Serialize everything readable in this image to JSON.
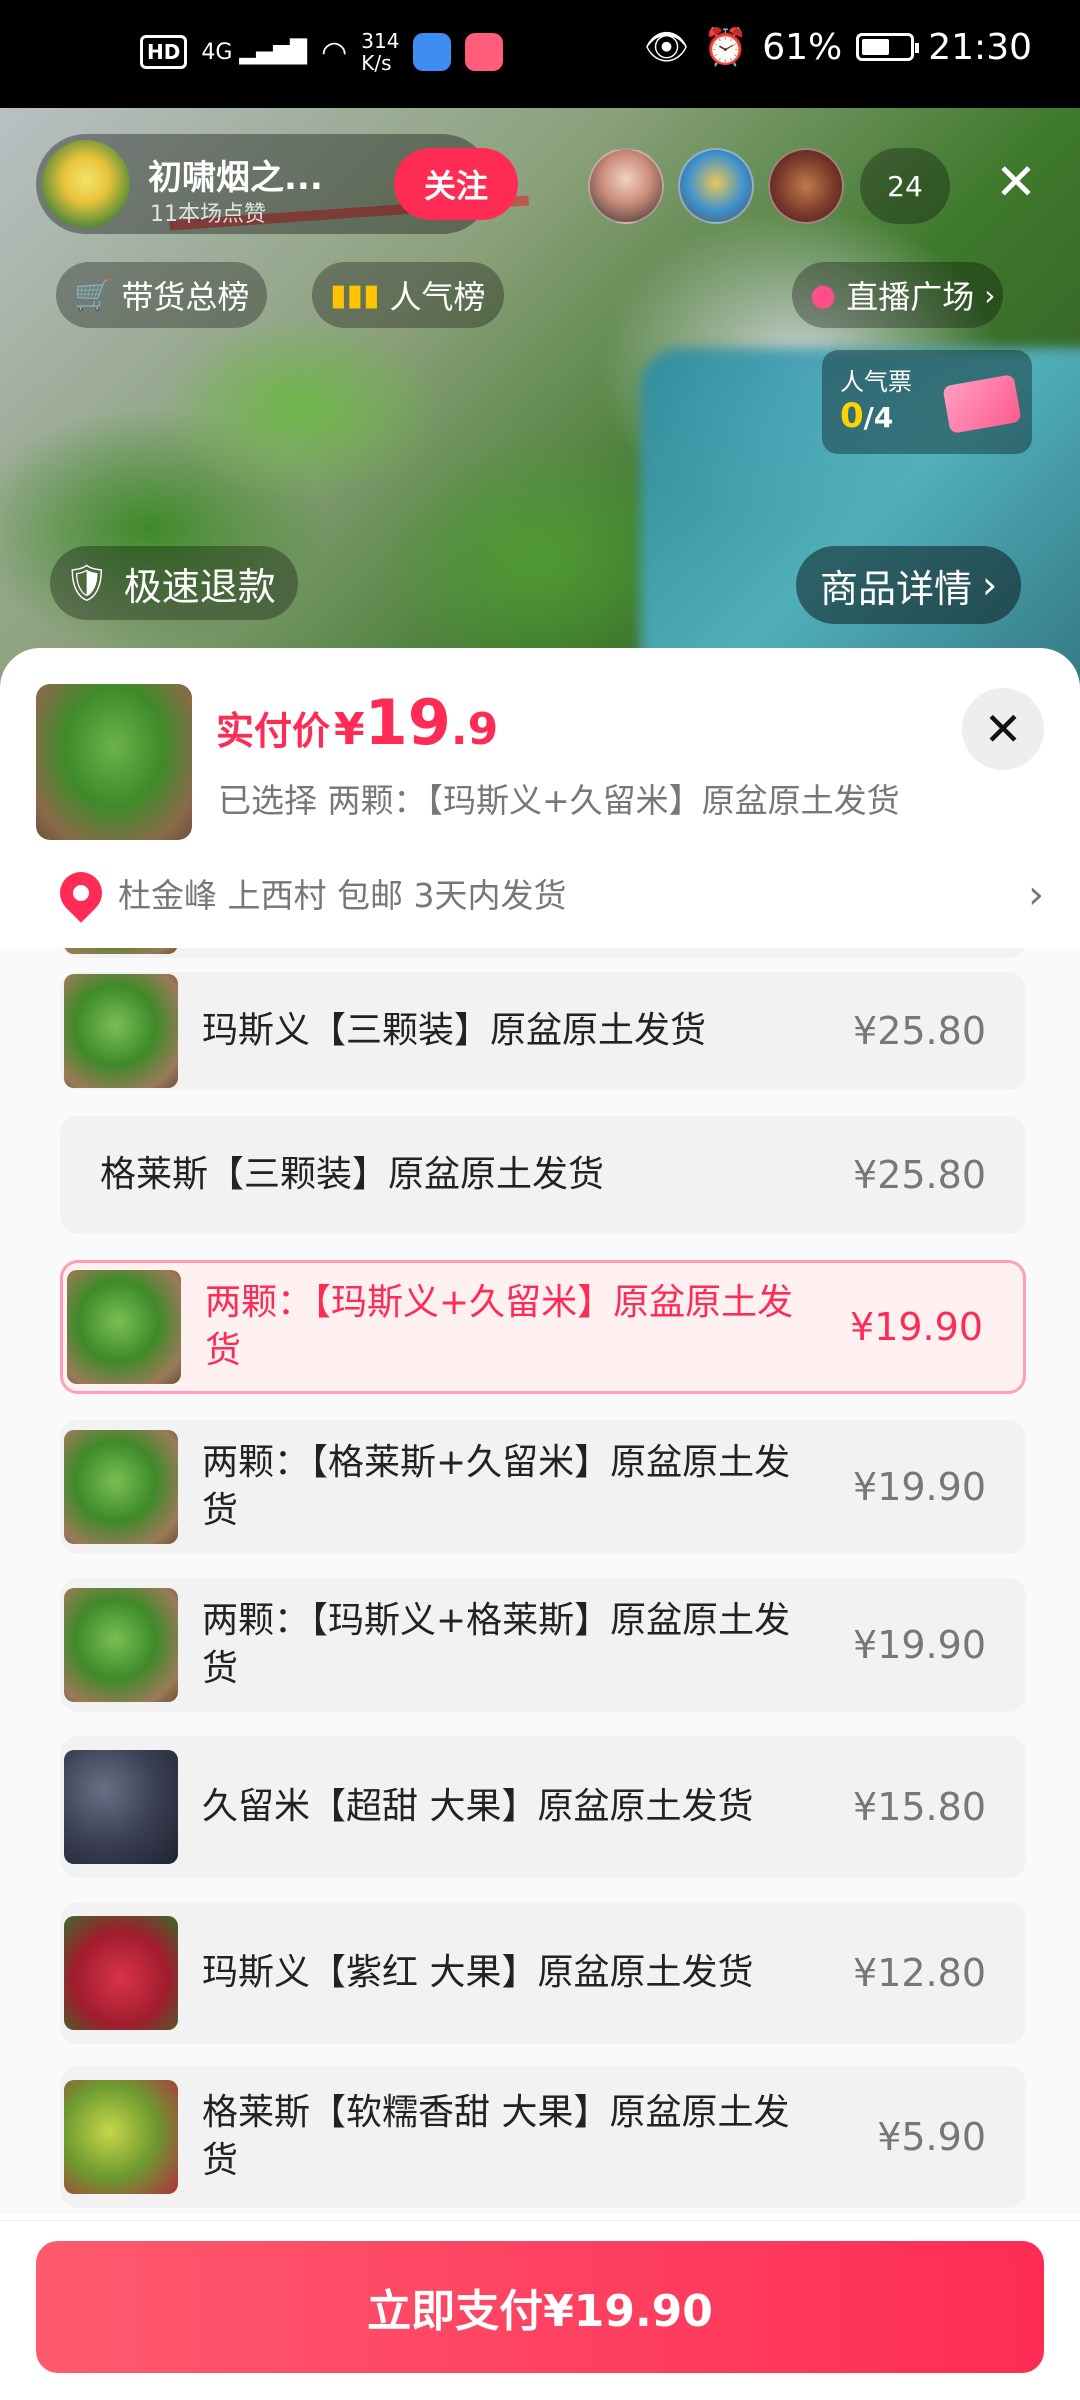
{
  "status_bar": {
    "hd": "HD",
    "signal": "4G",
    "speed_value": "314",
    "speed_unit": "K/s",
    "battery_percent": "61%",
    "time": "21:30"
  },
  "live": {
    "host_name": "初啸烟之...",
    "host_likes": "11本场点赞",
    "follow_label": "关注",
    "viewer_count": "24",
    "chips": {
      "sales_rank": "带货总榜",
      "popularity_rank": "人气榜",
      "live_square": "直播广场"
    },
    "votes": {
      "label": "人气票",
      "current": "0",
      "total": "/4"
    },
    "fast_refund": "极速退款",
    "product_details": "商品详情"
  },
  "sheet": {
    "paid_label": "实付价",
    "currency": "¥",
    "price_int": "19",
    "price_dec": ".9",
    "selected_text": "已选择 两颗：【玛斯义+久留米】原盆原土发货",
    "address": "杜金峰 上西村 包邮 3天内发货"
  },
  "options": [
    {
      "name": "玛斯义【三颗装】原盆原土发货",
      "price": "¥25.80"
    },
    {
      "name": "格莱斯【三颗装】原盆原土发货",
      "price": "¥25.80"
    },
    {
      "name": "两颗：【玛斯义+久留米】原盆原土发货",
      "price": "¥19.90"
    },
    {
      "name": "两颗：【格莱斯+久留米】原盆原土发货",
      "price": "¥19.90"
    },
    {
      "name": "两颗：【玛斯义+格莱斯】原盆原土发货",
      "price": "¥19.90"
    },
    {
      "name": "久留米【超甜 大果】原盆原土发货",
      "price": "¥15.80"
    },
    {
      "name": "玛斯义【紫红 大果】原盆原土发货",
      "price": "¥12.80"
    },
    {
      "name": "格莱斯【软糯香甜 大果】原盆原土发货",
      "price": "¥5.90"
    }
  ],
  "pay_button": "立即支付¥19.90",
  "colors": {
    "accent": "#fe2c55",
    "selected_border": "#ff9fb2",
    "selected_bg": "#fff0f2"
  }
}
